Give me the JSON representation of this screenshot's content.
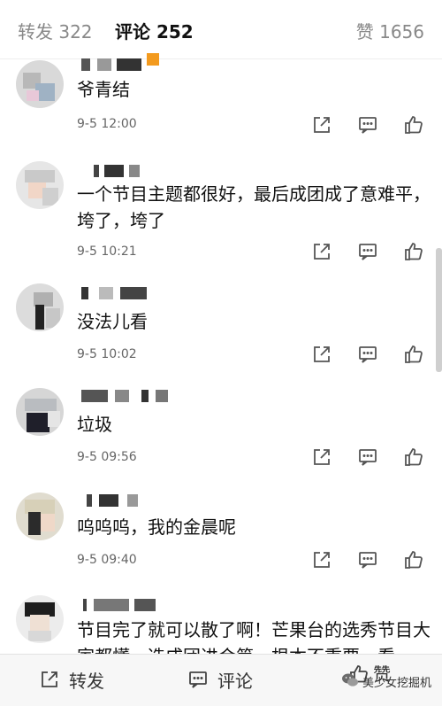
{
  "tabs": {
    "repost": "转发 322",
    "comment": "评论 252",
    "like": "赞 1656"
  },
  "comments": [
    {
      "text": "爷青结",
      "time": "9-5 12:00"
    },
    {
      "text": "一个节目主题都很好，最后成团成了意难平，垮了，垮了",
      "time": "9-5 10:21"
    },
    {
      "text": "没法儿看",
      "time": "9-5 10:02"
    },
    {
      "text": "垃圾",
      "time": "9-5 09:56"
    },
    {
      "text": "呜呜呜，我的金晨呢",
      "time": "9-5 09:40"
    },
    {
      "text": "节目完了就可以散了啊！芒果台的选秀节目大家都懂，选成团进会第，根本不重要，看"
    }
  ],
  "bottom_bar": {
    "repost": "转发",
    "comment": "评论",
    "like": "赞"
  },
  "watermark": "美少女挖掘机",
  "icons": {
    "share": "share-icon",
    "reply": "comment-icon",
    "like": "thumbs-up-icon"
  }
}
